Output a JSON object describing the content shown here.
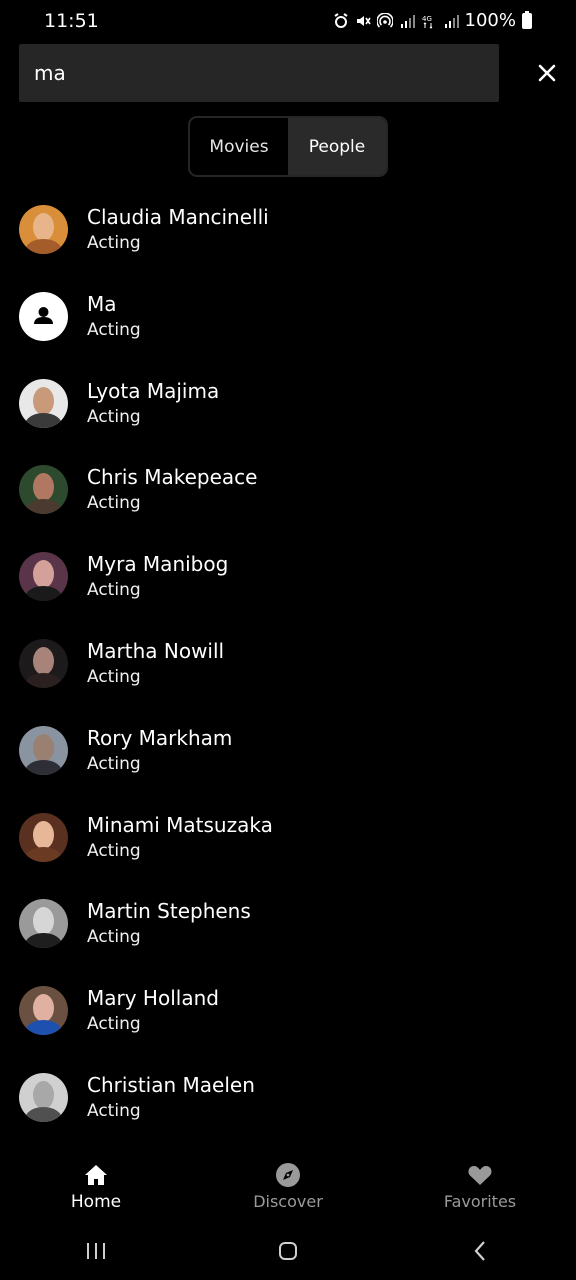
{
  "status_bar": {
    "time": "11:51",
    "battery": "100%",
    "icons": [
      "alarm-icon",
      "mute-icon",
      "hotspot-icon",
      "signal-icon",
      "4g-icon",
      "signal-icon",
      "battery-icon"
    ]
  },
  "search": {
    "value": "ma",
    "placeholder": ""
  },
  "tabs": {
    "movies": "Movies",
    "people": "People",
    "selected": "People"
  },
  "results": [
    {
      "name": "Claudia Mancinelli",
      "role": "Acting",
      "avatar": "photo"
    },
    {
      "name": "Ma",
      "role": "Acting",
      "avatar": "placeholder"
    },
    {
      "name": "Lyota Majima",
      "role": "Acting",
      "avatar": "photo"
    },
    {
      "name": "Chris Makepeace",
      "role": "Acting",
      "avatar": "photo"
    },
    {
      "name": "Myra Manibog",
      "role": "Acting",
      "avatar": "photo"
    },
    {
      "name": "Martha Nowill",
      "role": "Acting",
      "avatar": "photo"
    },
    {
      "name": "Rory Markham",
      "role": "Acting",
      "avatar": "photo"
    },
    {
      "name": "Minami Matsuzaka",
      "role": "Acting",
      "avatar": "photo"
    },
    {
      "name": "Martin Stephens",
      "role": "Acting",
      "avatar": "photo"
    },
    {
      "name": "Mary Holland",
      "role": "Acting",
      "avatar": "photo"
    },
    {
      "name": "Christian Maelen",
      "role": "Acting",
      "avatar": "photo"
    }
  ],
  "nav": {
    "home": "Home",
    "discover": "Discover",
    "favorites": "Favorites",
    "active": "Home"
  },
  "colors": {
    "background": "#000000",
    "search_bg": "#262626",
    "selected_tab_bg": "#2a2a2a",
    "inactive_nav": "#9a9a9a"
  }
}
